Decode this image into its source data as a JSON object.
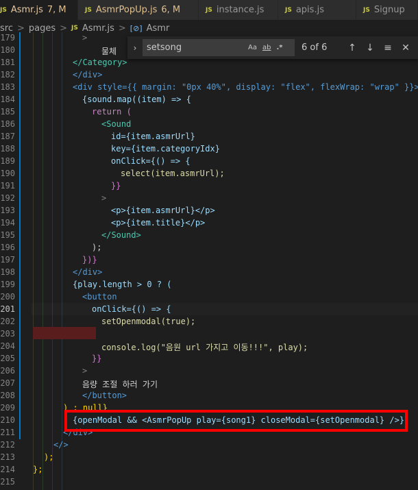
{
  "tabs": [
    {
      "label": "Asmr.js",
      "status": "7, M",
      "active": true
    },
    {
      "label": "AsmrPopUp.js",
      "status": "6, M",
      "active": false
    },
    {
      "label": "instance.js",
      "status": "",
      "active": false
    },
    {
      "label": "apis.js",
      "status": "",
      "active": false
    },
    {
      "label": "Signup",
      "status": "",
      "active": false
    }
  ],
  "tab_icon_text": "JS",
  "breadcrumb": {
    "items": [
      "src",
      "pages",
      "Asmr.js",
      "Asmr"
    ],
    "separator": ">"
  },
  "find_widget": {
    "query": "setsong",
    "options": [
      "Aa",
      "ab",
      ".*"
    ],
    "match_count": "6 of 6",
    "toggle_icon": "chevron-right-icon"
  },
  "line_numbers": [
    "179",
    "180",
    "181",
    "182",
    "183",
    "184",
    "185",
    "186",
    "187",
    "188",
    "189",
    "190",
    "191",
    "192",
    "193",
    "194",
    "195",
    "196",
    "197",
    "198",
    "199",
    "200",
    "201",
    "202",
    "203",
    "204",
    "205",
    "206",
    "207",
    "208",
    "209",
    "210",
    "211",
    "212",
    "213",
    "214",
    "215"
  ],
  "current_line": "201",
  "code": {
    "l179": ">",
    "l180_text": "물체",
    "l181": "</Category>",
    "l182": "</div>",
    "l183": "<div style={{ margin: \"0px 40%\", display: \"flex\", flexWrap: \"wrap\" }}>",
    "l184": "{sound.map((item) => {",
    "l185": "return (",
    "l186": "<Sound",
    "l187": "id={item.asmrUrl}",
    "l188": "key={item.categoryIdx}",
    "l189": "onClick={() => {",
    "l190": "select(item.asmrUrl);",
    "l191": "}}",
    "l192": ">",
    "l193": "<p>{item.asmrUrl}</p>",
    "l194": "<p>{item.title}</p>",
    "l195": "</Sound>",
    "l196": ");",
    "l197": "})}",
    "l198": "</div>",
    "l199": "{play.length > 0 ? (",
    "l200": "<button",
    "l201": "onClick={() => {",
    "l202": "setOpenmodal(true);",
    "l203": "",
    "l204": "console.log(\"음원 url 가지고 이동!!!\", play);",
    "l205": "}}",
    "l206": ">",
    "l207": "음량 조절 하러 가기",
    "l208": "</button>",
    "l209": ") : null}",
    "l210": "{openModal && <AsmrPopUp play={song1} closeModal={setOpenmodal} />}",
    "l211": "</div>",
    "l212": "</>",
    "l213": ");",
    "l214": "};",
    "l215": ""
  },
  "colors": {
    "background": "#1e1e1e",
    "highlight_box": "#ff0000",
    "error_band": "#5a1d1d"
  }
}
